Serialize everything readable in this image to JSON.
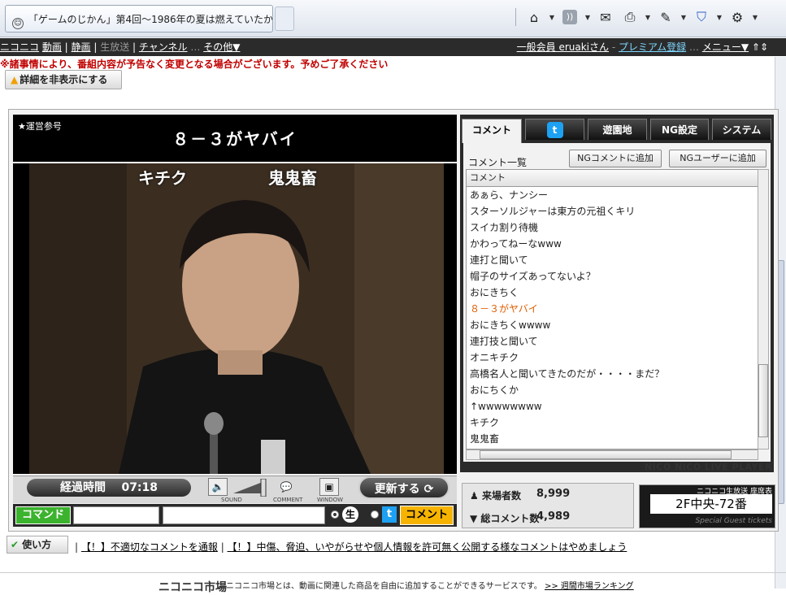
{
  "browser": {
    "tab_title": "「ゲームのじかん」第4回～1986年の夏は燃えていたか...",
    "toolbar_icons": [
      "home-icon",
      "feeds-icon",
      "mail-icon",
      "print-icon",
      "page-icon",
      "safety-icon",
      "tools-icon"
    ]
  },
  "sitenav": {
    "items": [
      "ニコニコ",
      "動画",
      "静画",
      "生放送",
      "チャンネル",
      "その他▼"
    ],
    "member": "一般会員 eruakiさん",
    "premium": "プレミアム登録",
    "menu": "メニュー▼",
    "dots": "…"
  },
  "notice": "※諸事情により、番組内容が予告なく変更となる場合がございます。予めご了承ください",
  "detail_button": "詳細を非表示にする",
  "player": {
    "telop_small": "★運営参号",
    "telop_big": "８－３がヤバイ",
    "caption_left": "キチク",
    "caption_right": "鬼鬼畜",
    "elapsed_label": "経過時間",
    "elapsed_value": "07:18",
    "sound_label": "SOUND",
    "comment_label": "COMMENT",
    "window_label": "WINDOW",
    "refresh_label": "更新する",
    "command_label": "コマンド",
    "live_glyph": "生",
    "twitter_glyph": "t",
    "comment_button": "コメント"
  },
  "panel": {
    "tabs": [
      "コメント",
      "t",
      "遊園地",
      "NG設定",
      "システム"
    ],
    "list_title": "コメント一覧",
    "ng_comment_btn": "NGコメントに追加",
    "ng_user_btn": "NGユーザーに追加",
    "column_header": "コメント",
    "comments": [
      "あぁら、ナンシー",
      "スターソルジャーは東方の元祖くキリ",
      "スイカ割り待機",
      "かわってねーなwww",
      "連打と聞いて",
      "帽子のサイズあってないよ？",
      "おにきちく",
      "８－３がヤバイ",
      "おにきちくwwww",
      "連打技と聞いて",
      "オニキチク",
      "高橋名人と聞いてきたのだが・・・・まだ？",
      "おにちくか",
      "↑wwwwwwww",
      "キチク",
      "鬼鬼畜"
    ],
    "highlight_index": 7,
    "brand": "NICO NICO LIVE PLAYER"
  },
  "stats": {
    "visitors_label": "来場者数",
    "visitors_value": "8,999",
    "comments_label": "総コメント数",
    "comments_value": "4,989"
  },
  "seat": {
    "top": "ニコニコ生放送 座席表",
    "value": "2F中央-72番",
    "bottom": "Special Guest tickets"
  },
  "footer": {
    "howto": "使い方",
    "rule1": "【！】不適切なコメントを通報",
    "rule2": "【！】中傷、脅迫、いやがらせや個人情報を許可無く公開する様なコメントはやめましょう",
    "logo": "ニコニコ市場",
    "desc": "ニコニコ市場とは、動画に関連した商品を自由に追加することができるサービスです。",
    "ranking": ">> 週間市場ランキング"
  }
}
